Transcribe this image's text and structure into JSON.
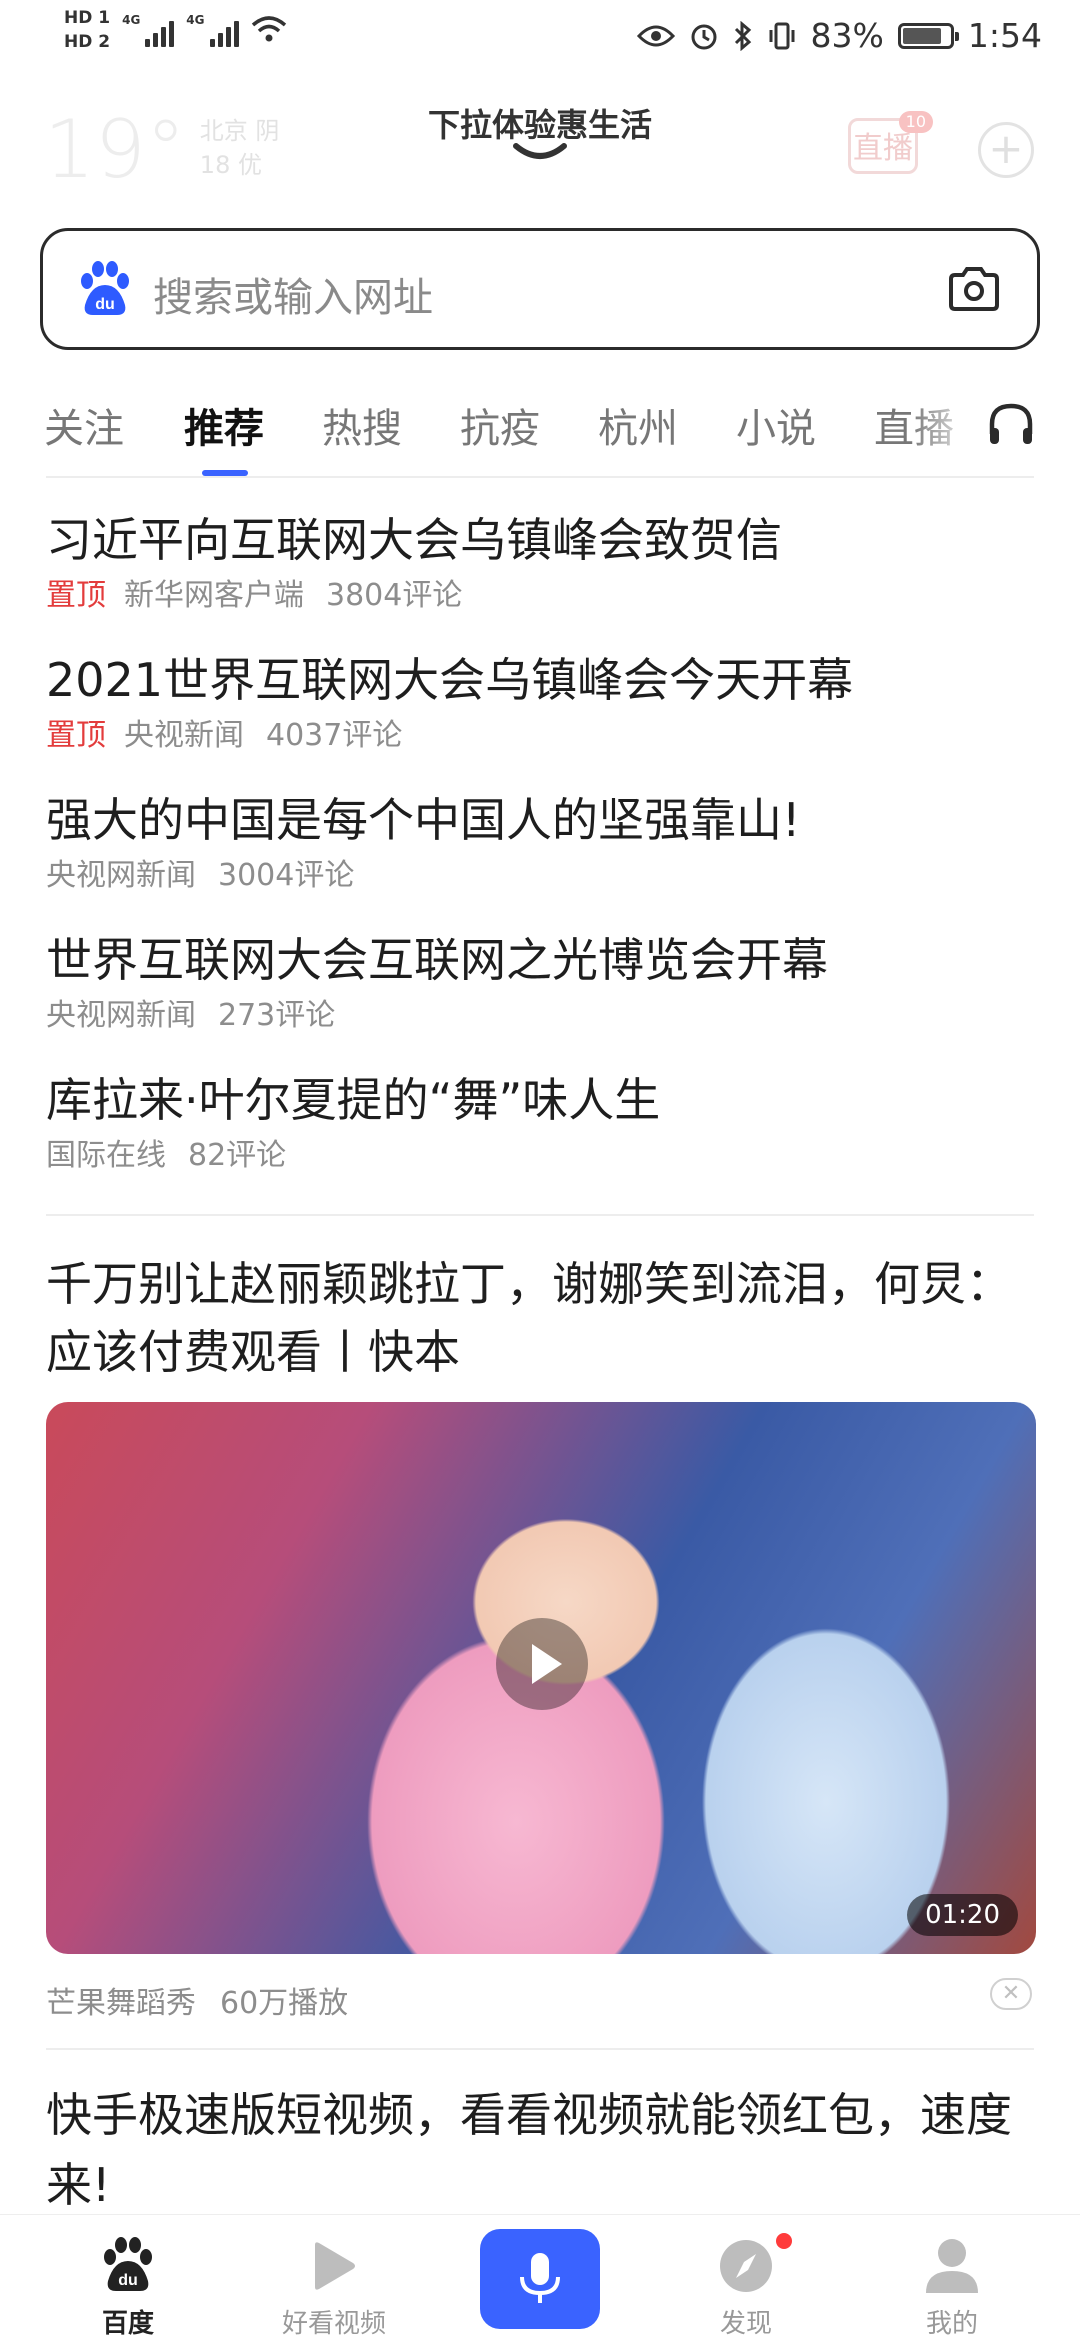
{
  "status_bar": {
    "hd1": "HD 1",
    "hd2": "HD 2",
    "net1": "4G",
    "net2": "4G",
    "battery_percent": "83%",
    "battery_level": 0.83,
    "time": "1:54"
  },
  "header": {
    "temperature": "19°",
    "city_weather": "北京 阴",
    "aqi": "18 优",
    "pull_title": "下拉体验惠生活",
    "live_label": "直播",
    "live_count": "10"
  },
  "search": {
    "placeholder": "搜索或输入网址"
  },
  "tabs": [
    "关注",
    "推荐",
    "热搜",
    "抗疫",
    "杭州",
    "小说",
    "直播"
  ],
  "active_tab": "推荐",
  "news": [
    {
      "title": "习近平向互联网大会乌镇峰会致贺信",
      "pin": "置顶",
      "source": "新华网客户端",
      "comments": "3804评论"
    },
    {
      "title": "2021世界互联网大会乌镇峰会今天开幕",
      "pin": "置顶",
      "source": "央视新闻",
      "comments": "4037评论"
    },
    {
      "title": "强大的中国是每个中国人的坚强靠山!",
      "pin": "",
      "source": "央视网新闻",
      "comments": "3004评论"
    },
    {
      "title": "世界互联网大会互联网之光博览会开幕",
      "pin": "",
      "source": "央视网新闻",
      "comments": "273评论"
    },
    {
      "title": "库拉来·叶尔夏提的“舞”味人生",
      "pin": "",
      "source": "国际在线",
      "comments": "82评论"
    }
  ],
  "video": {
    "title": "千万别让赵丽颖跳拉丁，谢娜笑到流泪，何炅：应该付费观看丨快本",
    "duration": "01:20",
    "source": "芒果舞蹈秀",
    "plays": "60万播放"
  },
  "next_item": {
    "title": "快手极速版短视频，看看视频就能领红包，速度来!"
  },
  "bottom_nav": [
    {
      "label": "百度"
    },
    {
      "label": "好看视频"
    },
    {
      "label": ""
    },
    {
      "label": "发现"
    },
    {
      "label": "我的"
    }
  ],
  "colors": {
    "accent": "#3a63ff",
    "pin_red": "#e33c3c"
  }
}
